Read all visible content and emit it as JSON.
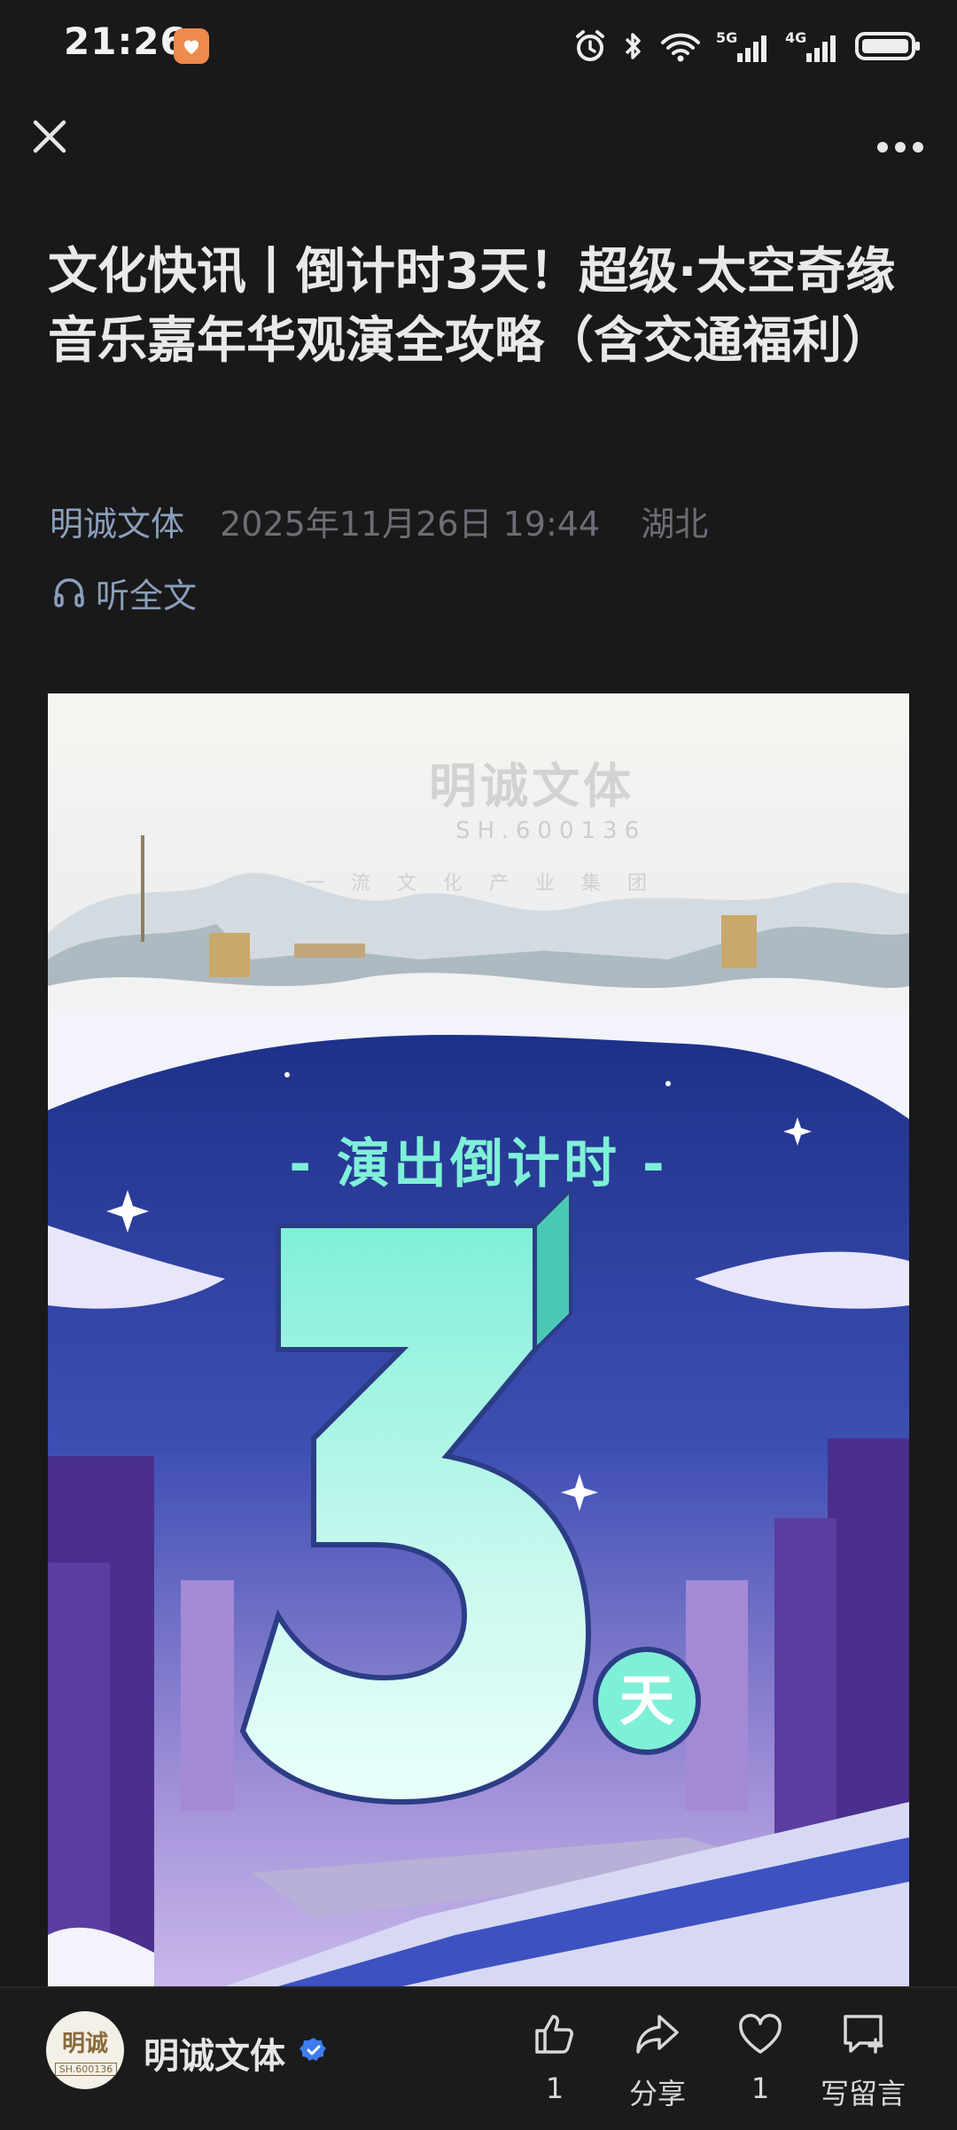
{
  "status_bar": {
    "time": "21:26",
    "network_1": "5G",
    "network_2": "4G"
  },
  "article": {
    "title": "文化快讯丨倒计时3天！超级·太空奇缘音乐嘉年华观演全攻略（含交通福利）",
    "author": "明诚文体",
    "date": "2025年11月26日 19:44",
    "location": "湖北",
    "listen_label": "听全文"
  },
  "poster": {
    "watermark_name": "明诚文体",
    "watermark_code": "SH.600136",
    "watermark_slogan": "一流文化产业集团",
    "headline": "- 演出倒计时 -",
    "count": "3",
    "unit": "天"
  },
  "bottom_bar": {
    "account_name": "明诚文体",
    "avatar_text": "明诚",
    "avatar_code": "SH.600136",
    "like_count": "1",
    "share_label": "分享",
    "favorite_count": "1",
    "comment_label": "写留言"
  },
  "colors": {
    "background": "#191919",
    "link": "#8b9fbc",
    "meta": "#6b6e75",
    "poster_accent": "#7ff0d8",
    "badge": "#ee8a4b",
    "verified": "#3d7cf0"
  }
}
